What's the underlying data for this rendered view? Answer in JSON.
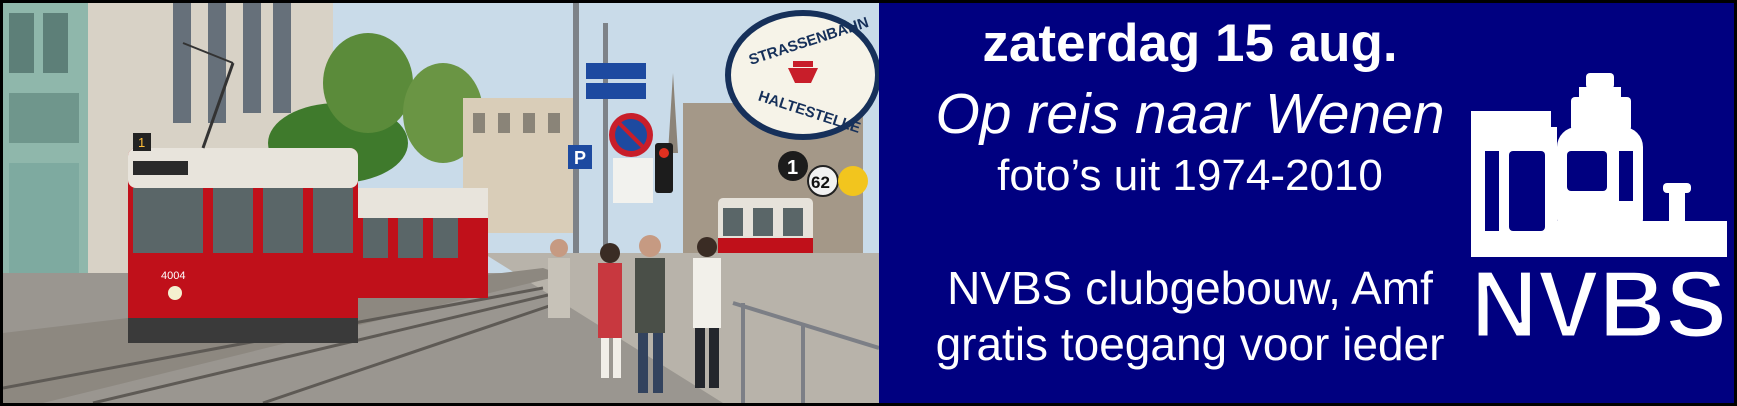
{
  "event": {
    "date_line": "zaterdag 15 aug.",
    "title_line": "Op reis naar Wenen",
    "subtitle_line": "foto’s uit 1974-2010",
    "venue_line": "NVBS clubgebouw, Amf",
    "admission_line": "gratis toegang voor ieder"
  },
  "photo": {
    "stop_sign_top": "STRASSENBAHN",
    "stop_sign_bottom": "HALTESTELLE",
    "tram_number": "4004",
    "tram_route_sign": "1",
    "route_badge_1": "1",
    "route_badge_2": "62",
    "parking_sign": "P"
  },
  "logo": {
    "text": "NVBS"
  },
  "colors": {
    "panel_background": "#000080",
    "text": "#ffffff",
    "tram_red": "#c0101a"
  }
}
